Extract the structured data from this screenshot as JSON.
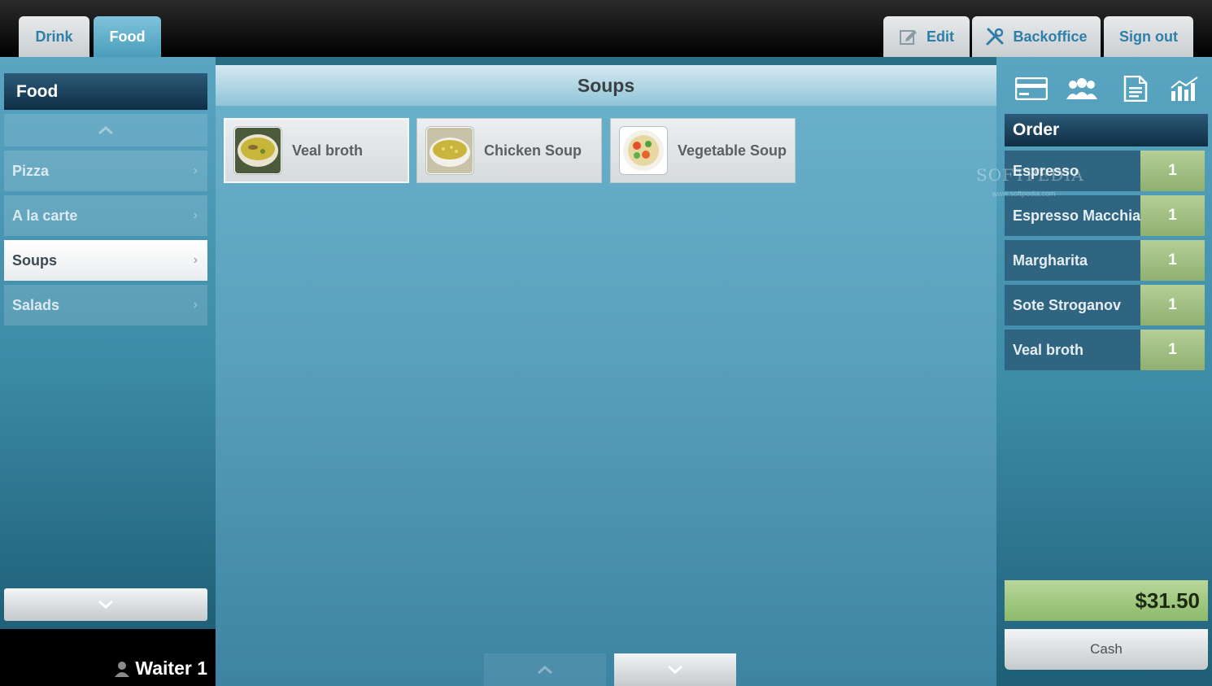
{
  "top_tabs": {
    "drink": "Drink",
    "food": "Food"
  },
  "toolbar": {
    "edit": "Edit",
    "backoffice": "Backoffice",
    "signout": "Sign out"
  },
  "categories": {
    "header": "Food",
    "items": [
      {
        "label": "Pizza",
        "active": false
      },
      {
        "label": "A la carte",
        "active": false
      },
      {
        "label": "Soups",
        "active": true
      },
      {
        "label": "Salads",
        "active": false
      }
    ]
  },
  "waiter": "Waiter 1",
  "products": {
    "title": "Soups",
    "items": [
      {
        "name": "Veal broth",
        "icon": "veal-broth-soup-bowl"
      },
      {
        "name": "Chicken Soup",
        "icon": "chicken-soup-bowl"
      },
      {
        "name": "Vegetable Soup",
        "icon": "vegetable-soup-bowl"
      }
    ]
  },
  "order": {
    "header": "Order",
    "items": [
      {
        "name": "Espresso",
        "qty": "1"
      },
      {
        "name": "Espresso Macchiato",
        "qty": "1"
      },
      {
        "name": "Margharita",
        "qty": "1"
      },
      {
        "name": "Sote Stroganov",
        "qty": "1"
      },
      {
        "name": "Veal broth",
        "qty": "1"
      }
    ],
    "total": "$31.50",
    "cash": "Cash"
  },
  "watermark": {
    "text": "SOFTPEDIA",
    "sub": "www.softpedia.com"
  },
  "colors": {
    "accent_blue": "#2d7fa8",
    "qty_green": "#9fc07f",
    "header_dark": "#1c4560"
  }
}
